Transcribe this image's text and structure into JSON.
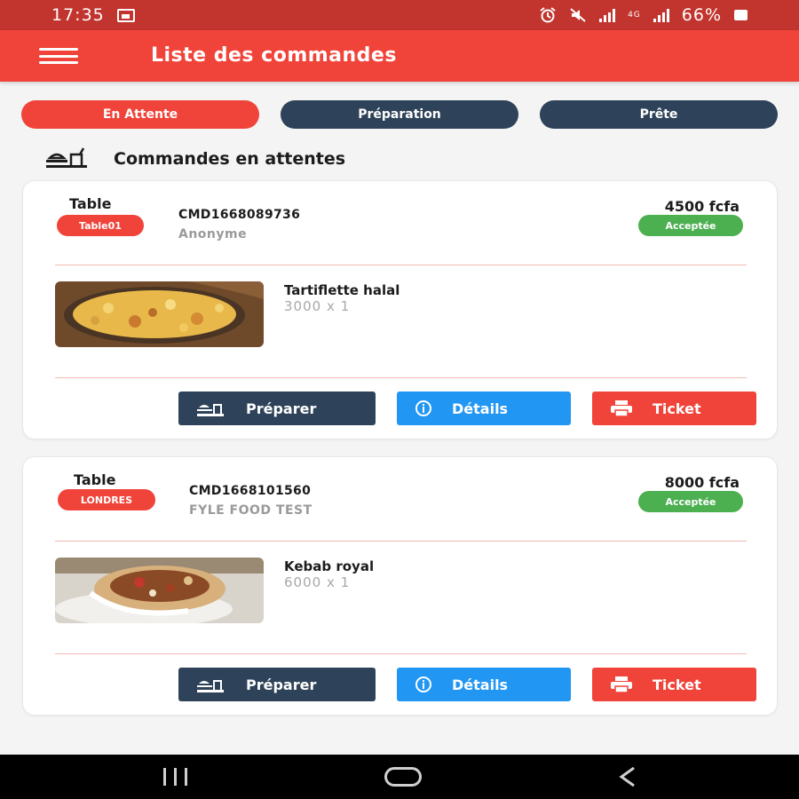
{
  "status_bar": {
    "time": "17:35",
    "network": "4G",
    "battery": "66%"
  },
  "app_bar": {
    "title": "Liste des commandes"
  },
  "tabs": [
    {
      "label": "En Attente",
      "active": true
    },
    {
      "label": "Préparation",
      "active": false
    },
    {
      "label": "Prête",
      "active": false
    }
  ],
  "section": {
    "title": "Commandes en attentes"
  },
  "orders": [
    {
      "table_label": "Table",
      "table_name": "Table01",
      "order_id": "CMD1668089736",
      "client": "Anonyme",
      "total": "4500 fcfa",
      "status": "Acceptée",
      "item": {
        "name": "Tartiflette halal",
        "qty": "3000 x 1"
      },
      "buttons": {
        "prepare": "Préparer",
        "details": "Détails",
        "ticket": "Ticket"
      }
    },
    {
      "table_label": "Table",
      "table_name": "LONDRES",
      "order_id": "CMD1668101560",
      "client": "FYLE FOOD TEST",
      "total": "8000 fcfa",
      "status": "Acceptée",
      "item": {
        "name": "Kebab royal",
        "qty": "6000 x 1"
      },
      "buttons": {
        "prepare": "Préparer",
        "details": "Détails",
        "ticket": "Ticket"
      }
    }
  ],
  "colors": {
    "primary": "#f0443a",
    "dark": "#2e4259",
    "info": "#2196f3",
    "success": "#4caf50"
  }
}
